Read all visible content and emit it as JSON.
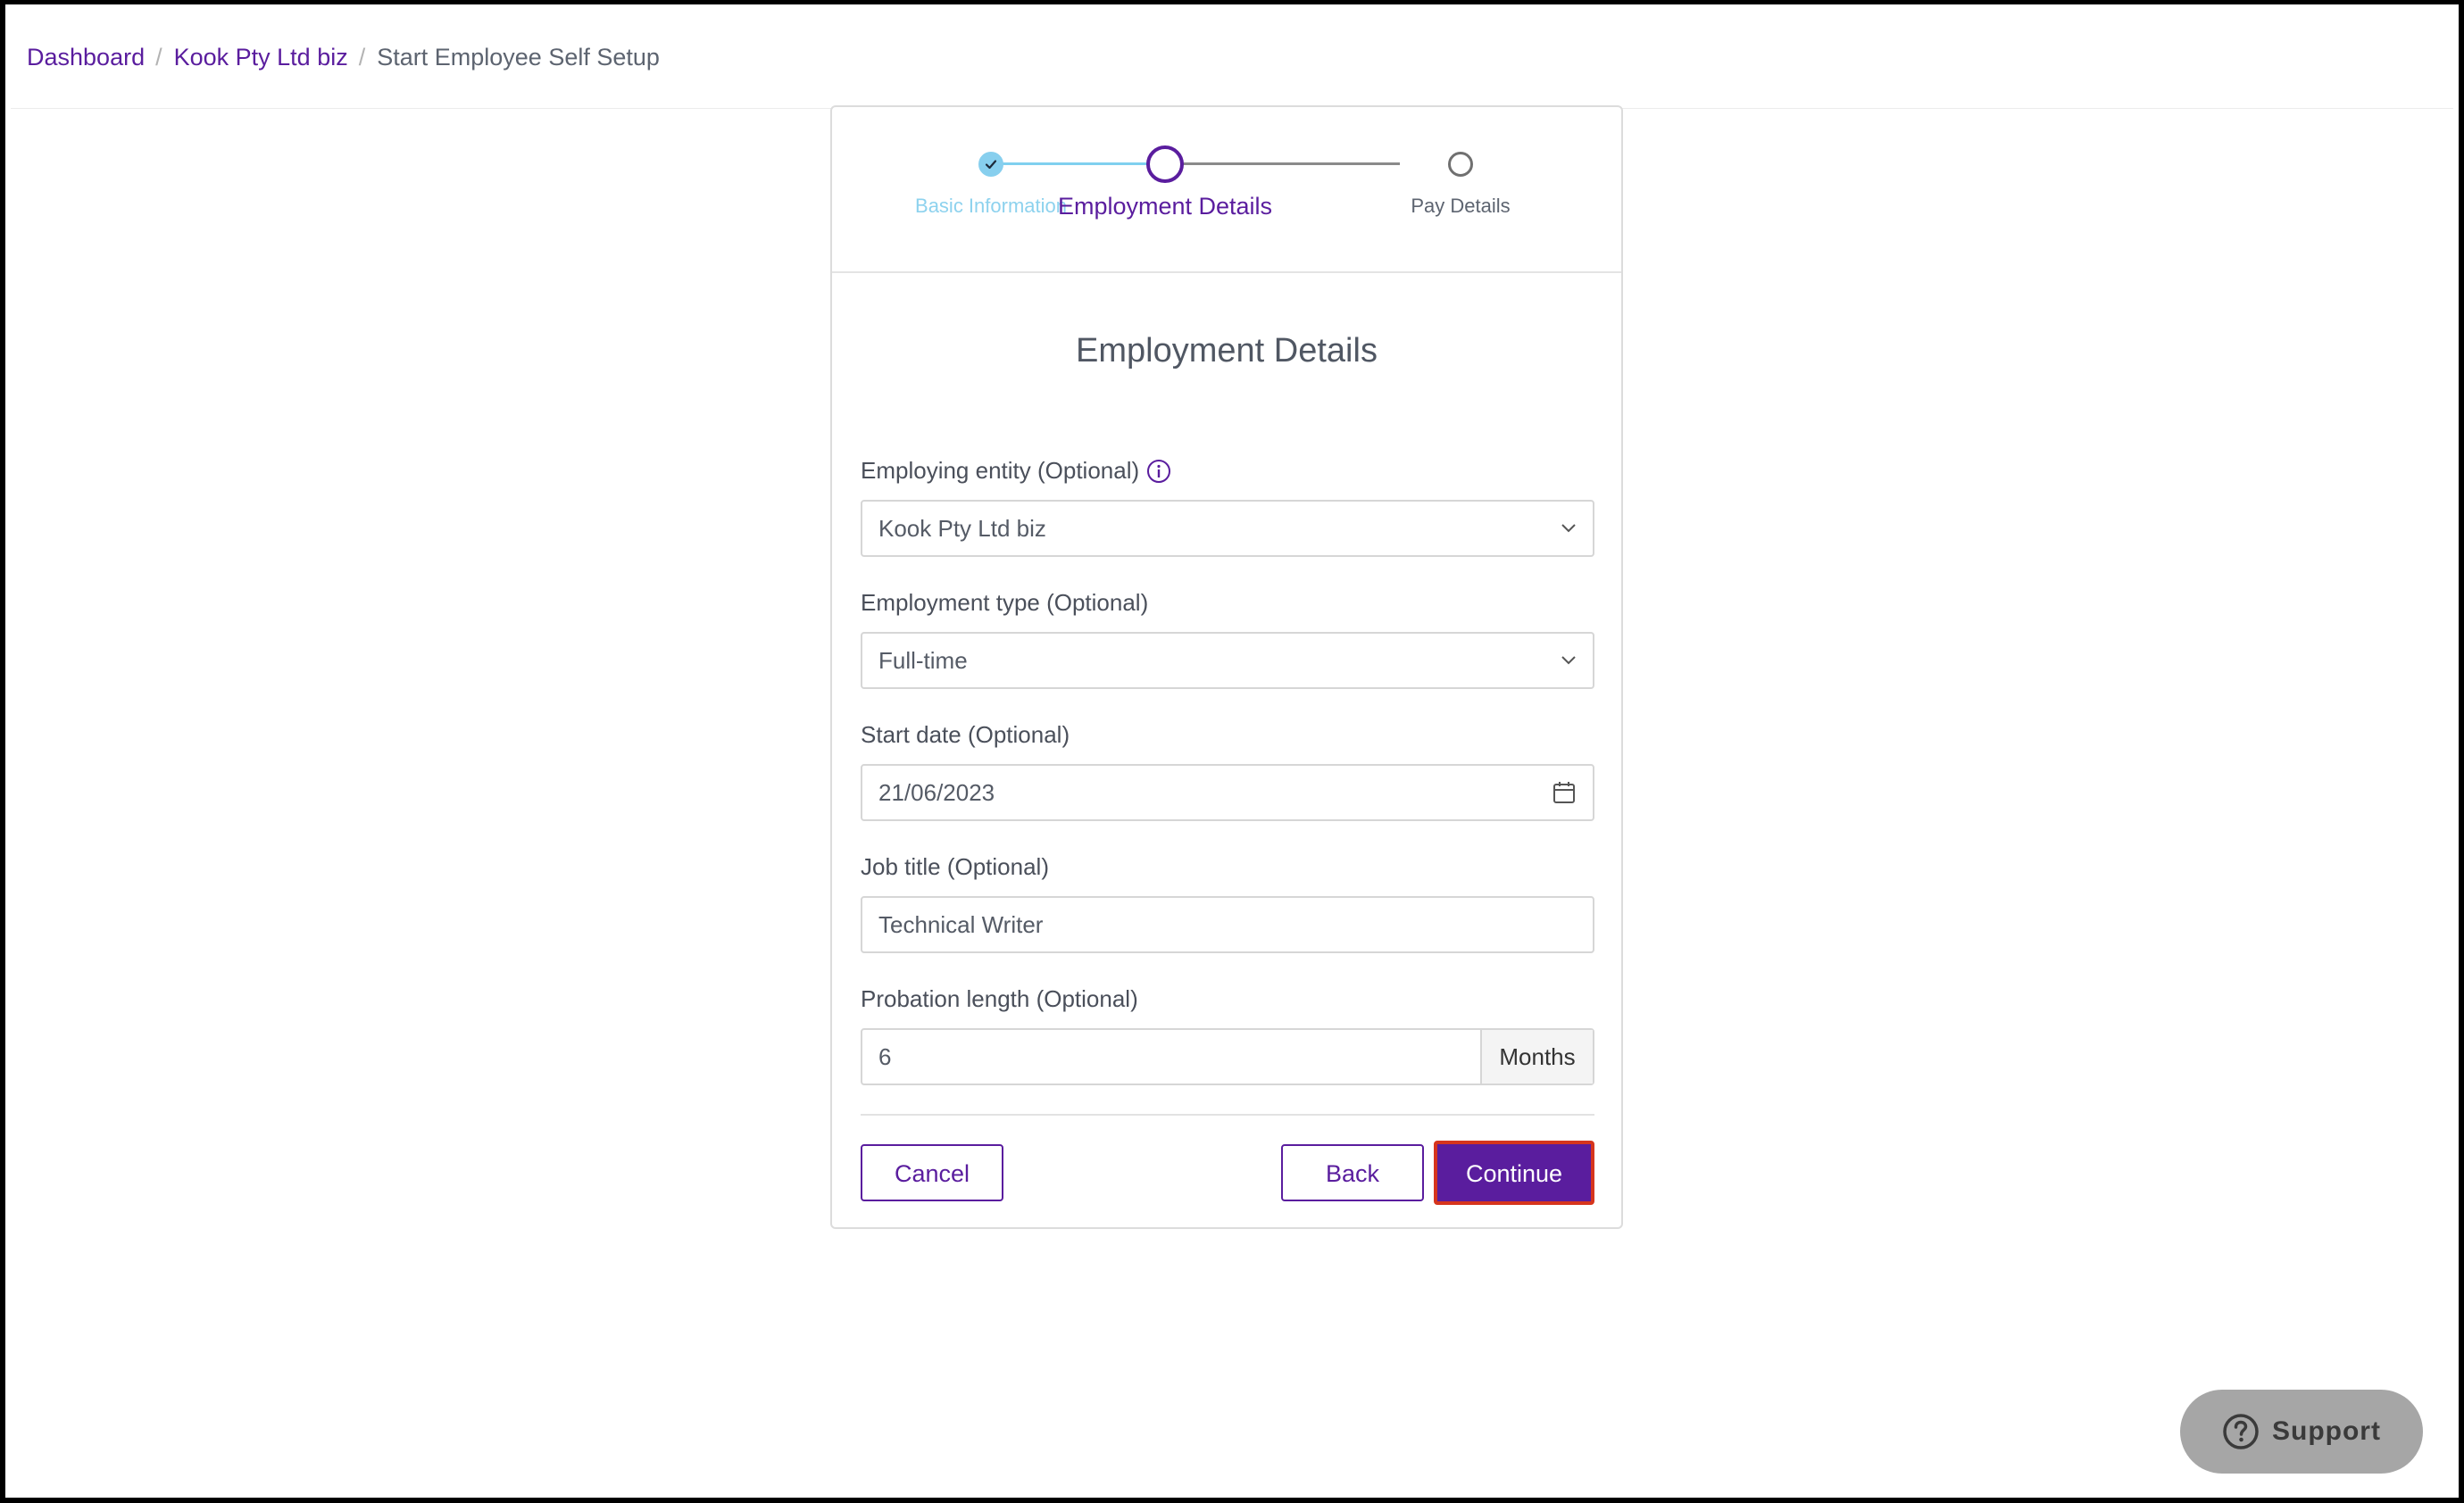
{
  "breadcrumb": {
    "items": [
      "Dashboard",
      "Kook Pty Ltd biz"
    ],
    "current": "Start Employee Self Setup",
    "separator": "/"
  },
  "stepper": {
    "steps": [
      {
        "label": "Basic Information",
        "state": "completed"
      },
      {
        "label": "Employment Details",
        "state": "active"
      },
      {
        "label": "Pay Details",
        "state": "upcoming"
      }
    ]
  },
  "form": {
    "title": "Employment Details",
    "employing_entity": {
      "label": "Employing entity (Optional)",
      "value": "Kook Pty Ltd biz"
    },
    "employment_type": {
      "label": "Employment type (Optional)",
      "value": "Full-time"
    },
    "start_date": {
      "label": "Start date (Optional)",
      "value": "21/06/2023"
    },
    "job_title": {
      "label": "Job title (Optional)",
      "value": "Technical Writer"
    },
    "probation": {
      "label": "Probation length (Optional)",
      "value": "6",
      "unit": "Months"
    }
  },
  "actions": {
    "cancel": "Cancel",
    "back": "Back",
    "continue": "Continue"
  },
  "support": {
    "label": "Support"
  },
  "colors": {
    "brand": "#5a1d9e",
    "step_done": "#87cfee",
    "focus_outline": "#d6351d",
    "support_bg": "#a6a6a6"
  }
}
